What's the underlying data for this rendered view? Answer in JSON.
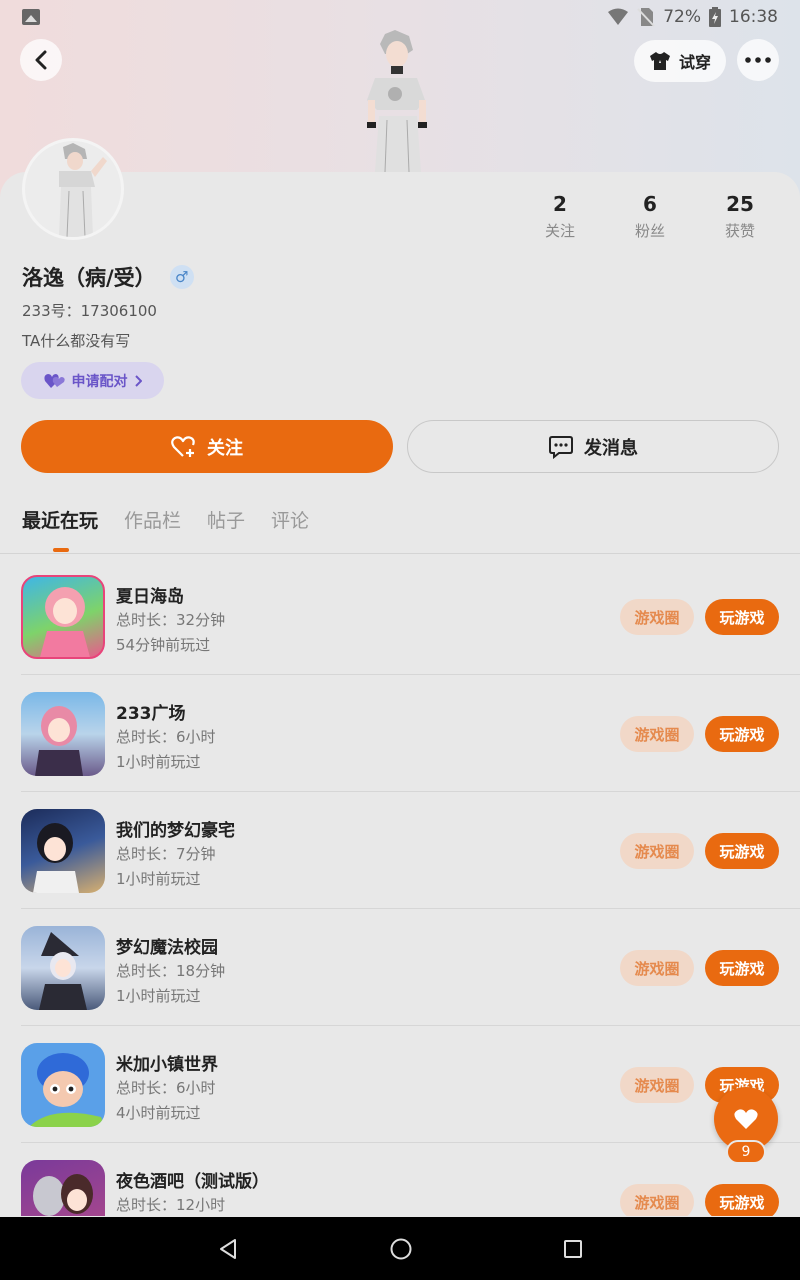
{
  "status_bar": {
    "battery": "72%",
    "time": "16:38"
  },
  "header": {
    "tryon_label": "试穿"
  },
  "profile": {
    "name": "洛逸（病/受）",
    "gender_symbol": "♂",
    "uid": "233号：17306100",
    "bio": "TA什么都没有写",
    "pair_label": "申请配对",
    "stats": [
      {
        "value": "2",
        "label": "关注"
      },
      {
        "value": "6",
        "label": "粉丝"
      },
      {
        "value": "25",
        "label": "获赞"
      }
    ]
  },
  "actions": {
    "follow_label": "关注",
    "message_label": "发消息"
  },
  "tabs": [
    {
      "label": "最近在玩",
      "active": true
    },
    {
      "label": "作品栏",
      "active": false
    },
    {
      "label": "帖子",
      "active": false
    },
    {
      "label": "评论",
      "active": false
    }
  ],
  "games": [
    {
      "title": "夏日海岛",
      "duration": "总时长：32分钟",
      "last_played": "54分钟前玩过",
      "circle_label": "游戏圈",
      "play_label": "玩游戏",
      "icon": "summer-island-icon"
    },
    {
      "title": "233广场",
      "duration": "总时长：6小时",
      "last_played": "1小时前玩过",
      "circle_label": "游戏圈",
      "play_label": "玩游戏",
      "icon": "plaza-icon"
    },
    {
      "title": "我们的梦幻豪宅",
      "duration": "总时长：7分钟",
      "last_played": "1小时前玩过",
      "circle_label": "游戏圈",
      "play_label": "玩游戏",
      "icon": "dream-mansion-icon"
    },
    {
      "title": "梦幻魔法校园",
      "duration": "总时长：18分钟",
      "last_played": "1小时前玩过",
      "circle_label": "游戏圈",
      "play_label": "玩游戏",
      "icon": "magic-school-icon"
    },
    {
      "title": "米加小镇世界",
      "duration": "总时长：6小时",
      "last_played": "4小时前玩过",
      "circle_label": "游戏圈",
      "play_label": "玩游戏",
      "icon": "miga-town-icon"
    },
    {
      "title": "夜色酒吧（测试版）",
      "duration": "总时长：12小时",
      "last_played": "",
      "circle_label": "游戏圈",
      "play_label": "玩游戏",
      "icon": "night-bar-icon"
    }
  ],
  "like_fab": {
    "count": "9"
  },
  "colors": {
    "accent": "#e96a10",
    "pair_purple": "#6a55c8"
  }
}
